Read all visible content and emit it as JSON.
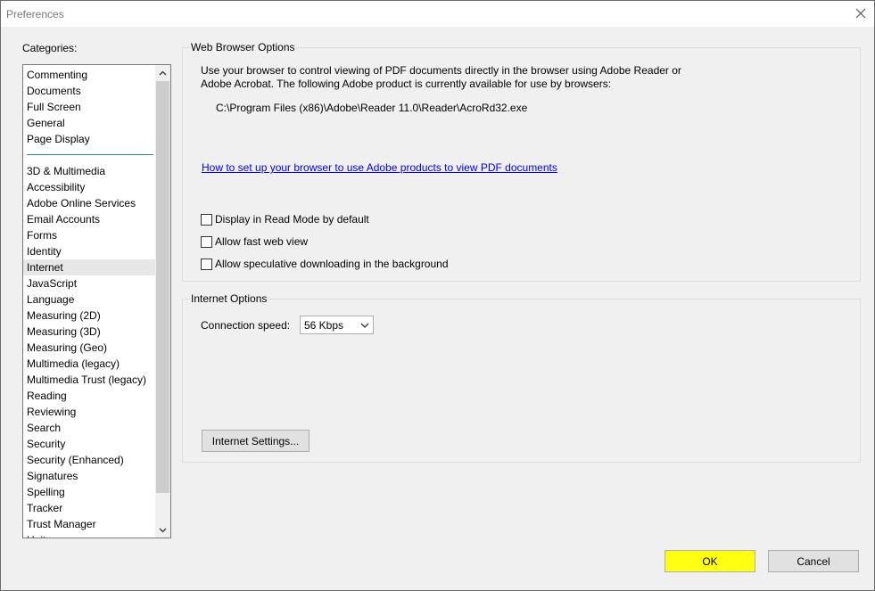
{
  "window": {
    "title": "Preferences"
  },
  "categories": {
    "label": "Categories:",
    "group1": [
      "Commenting",
      "Documents",
      "Full Screen",
      "General",
      "Page Display"
    ],
    "group2": [
      "3D & Multimedia",
      "Accessibility",
      "Adobe Online Services",
      "Email Accounts",
      "Forms",
      "Identity",
      "Internet",
      "JavaScript",
      "Language",
      "Measuring (2D)",
      "Measuring (3D)",
      "Measuring (Geo)",
      "Multimedia (legacy)",
      "Multimedia Trust (legacy)",
      "Reading",
      "Reviewing",
      "Search",
      "Security",
      "Security (Enhanced)",
      "Signatures",
      "Spelling",
      "Tracker",
      "Trust Manager",
      "Units"
    ],
    "selected": "Internet"
  },
  "web_browser_options": {
    "title": "Web Browser Options",
    "description": "Use your browser to control viewing of PDF documents directly in the browser using Adobe Reader or Adobe Acrobat. The following Adobe product is currently available for use by browsers:",
    "path": "C:\\Program Files (x86)\\Adobe\\Reader 11.0\\Reader\\AcroRd32.exe",
    "link": "How to set up your browser to use Adobe products to view PDF documents",
    "checkboxes": [
      {
        "label": "Display in Read Mode by default",
        "checked": false
      },
      {
        "label": "Allow fast web view",
        "checked": false
      },
      {
        "label": "Allow speculative downloading in the background",
        "checked": false
      }
    ]
  },
  "internet_options": {
    "title": "Internet Options",
    "connection_label": "Connection speed:",
    "connection_value": "56 Kbps",
    "settings_button": "Internet Settings..."
  },
  "footer": {
    "ok": "OK",
    "cancel": "Cancel"
  },
  "colors": {
    "ok_highlight": "#ffff11",
    "link": "#0000ee",
    "list_separator": "#2e8b8b"
  }
}
